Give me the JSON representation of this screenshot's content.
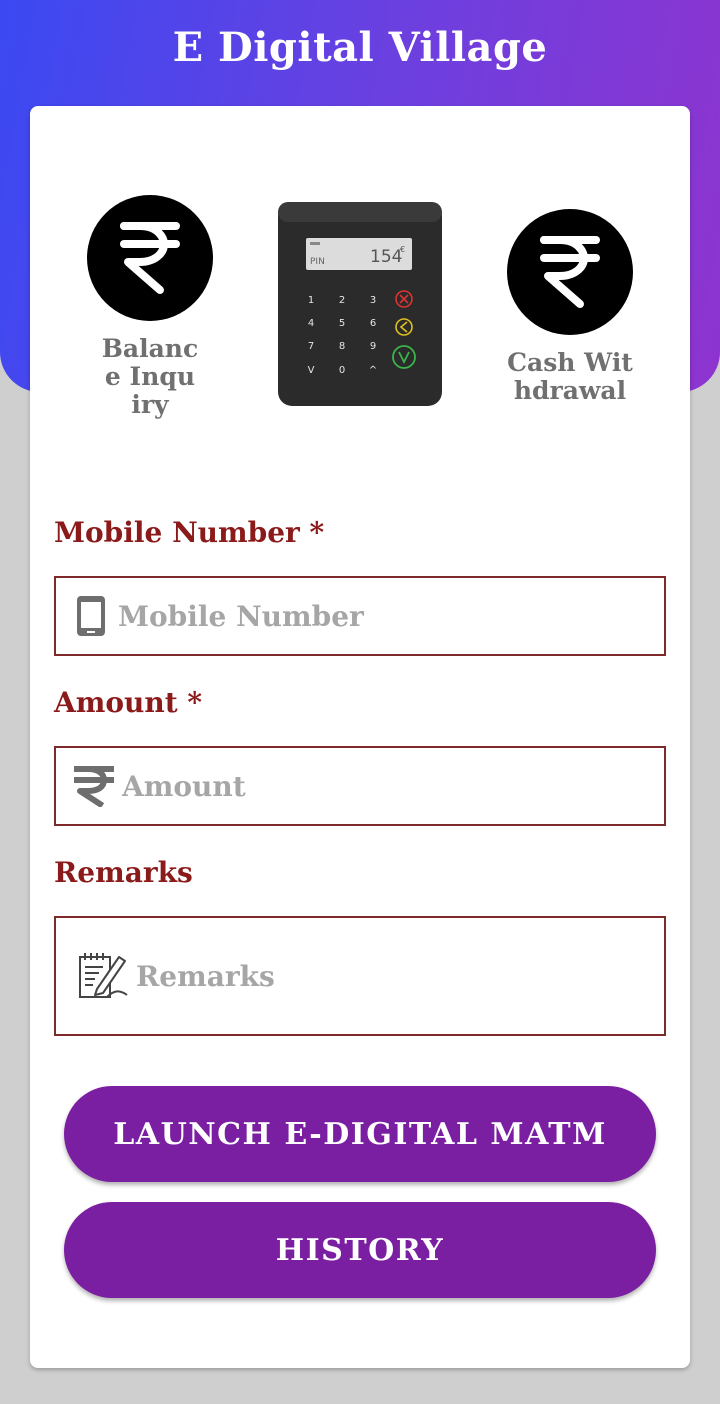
{
  "app": {
    "title": "E Digital Village"
  },
  "options": {
    "balance_inquiry": "Balance Inquiry",
    "cash_withdrawal": "Cash Withdrawal"
  },
  "device": {
    "screen_label": "PIN",
    "screen_amount": "154",
    "screen_currency": "€"
  },
  "form": {
    "mobile": {
      "label": "Mobile Number *",
      "placeholder": "Mobile Number",
      "value": ""
    },
    "amount": {
      "label": "Amount *",
      "placeholder": "Amount",
      "value": ""
    },
    "remarks": {
      "label": "Remarks",
      "placeholder": "Remarks",
      "value": ""
    }
  },
  "buttons": {
    "launch": "LAUNCH E-DIGITAL MATM",
    "history": "HISTORY"
  },
  "colors": {
    "header_start": "#3b49f2",
    "header_end": "#8e34cf",
    "label": "#8b1a1a",
    "button": "#7b1fa2"
  }
}
